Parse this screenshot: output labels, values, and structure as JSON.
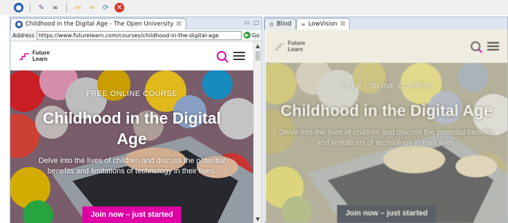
{
  "toolbar": {
    "icons": [
      "globe-icon",
      "accessibility-icon",
      "binoculars-icon",
      "back-icon",
      "forward-icon",
      "refresh-icon",
      "stop-icon"
    ]
  },
  "left": {
    "tab_title": "Childhood in the Digital Age - The Open University",
    "tab_close": "⊠",
    "address_label": "Address",
    "url": "https://www.futurelearn.com/courses/childhood-in-the-digital-age",
    "go_label": "Go"
  },
  "right": {
    "tab_blind": "Blind",
    "tab_lowvision": "LowVision",
    "tab_close": "⊠"
  },
  "site": {
    "logo_line1": "Future",
    "logo_line2": "Learn",
    "eyebrow": "FREE ONLINE COURSE",
    "title": "Childhood in the Digital Age",
    "description": "Delve into the lives of children and discuss the potential benefits and limitations of technology in their lives.",
    "cta": "Join now – just started"
  },
  "colors": {
    "brand_pink": "#de00a5",
    "lowvision_button": "#5a5f66",
    "lowvision_header": "#eeede0"
  }
}
